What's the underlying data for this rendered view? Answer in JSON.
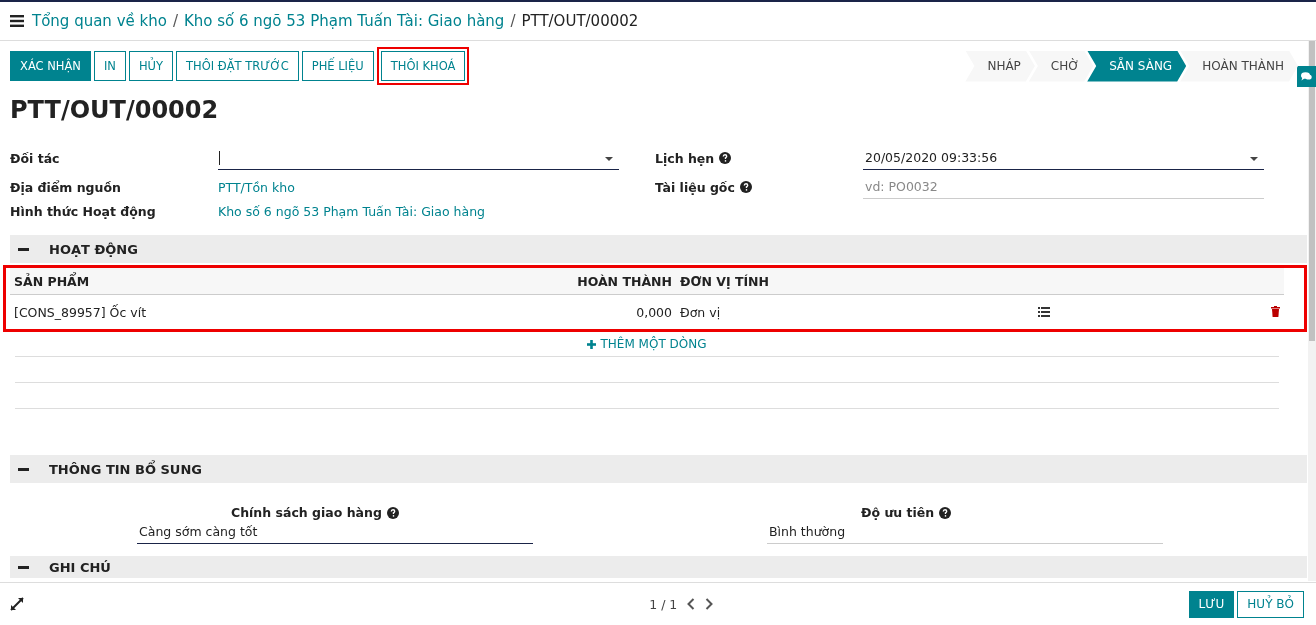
{
  "breadcrumbs": [
    {
      "label": "Tổng quan về kho",
      "link": true
    },
    {
      "separator": "/",
      "label": "Kho số 6 ngõ 53 Phạm Tuấn Tài: Giao hàng",
      "link": true
    },
    {
      "separator": "/",
      "label": "PTT/OUT/00002",
      "link": false
    }
  ],
  "actions": [
    {
      "label": "XÁC NHẬN",
      "primary": true,
      "highlighted": false
    },
    {
      "label": "IN",
      "primary": false,
      "highlighted": false
    },
    {
      "label": "HỦY",
      "primary": false,
      "highlighted": false
    },
    {
      "label": "THÔI ĐẶT TRƯỚC",
      "primary": false,
      "highlighted": false
    },
    {
      "label": "PHẾ LIỆU",
      "primary": false,
      "highlighted": false
    },
    {
      "label": "THÔI KHOÁ",
      "primary": false,
      "highlighted": true
    }
  ],
  "stages": [
    {
      "label": "NHÁP",
      "selected": false
    },
    {
      "label": "CHỜ",
      "selected": false
    },
    {
      "label": "SẴN SÀNG",
      "selected": true
    },
    {
      "label": "HOÀN THÀNH",
      "selected": false
    }
  ],
  "title": "PTT/OUT/00002",
  "left_fields": [
    {
      "label": "Đối tác",
      "kind": "select"
    },
    {
      "label": "Địa điểm nguồn",
      "kind": "link",
      "value": "PTT/Tồn kho"
    },
    {
      "label": "Hình thức Hoạt động",
      "kind": "link",
      "value": "Kho số 6 ngõ 53 Phạm Tuấn Tài: Giao hàng"
    }
  ],
  "right_fields": [
    {
      "label": "Lịch hẹn",
      "kind": "select",
      "value": "20/05/2020 09:33:56"
    },
    {
      "label": "Tài liệu gốc",
      "kind": "input",
      "placeholder": "vd: PO0032"
    }
  ],
  "operations": {
    "heading": "HOẠT ĐỘNG",
    "highlighted": true,
    "columns": [
      "SẢN PHẨM",
      "HOÀN THÀNH",
      "ĐƠN VỊ TÍNH"
    ],
    "rows": [
      {
        "product": "[CONS_89957] Ốc vít",
        "done": "0,000",
        "uom": "Đơn vị"
      }
    ],
    "add_line": "THÊM MỘT DÒNG"
  },
  "extra": {
    "heading": "THÔNG TIN BỔ SUNG",
    "fields": [
      {
        "label": "Chính sách giao hàng",
        "value": "Càng sớm càng tốt",
        "focused": true
      },
      {
        "label": "Độ ưu tiên",
        "value": "Bình thường",
        "focused": false
      }
    ]
  },
  "notes": {
    "heading": "GHI CHÚ"
  },
  "pager": "1 / 1",
  "footer_buttons": [
    {
      "label": "LƯU",
      "primary": true
    },
    {
      "label": "HUỶ BỎ",
      "primary": false
    }
  ]
}
